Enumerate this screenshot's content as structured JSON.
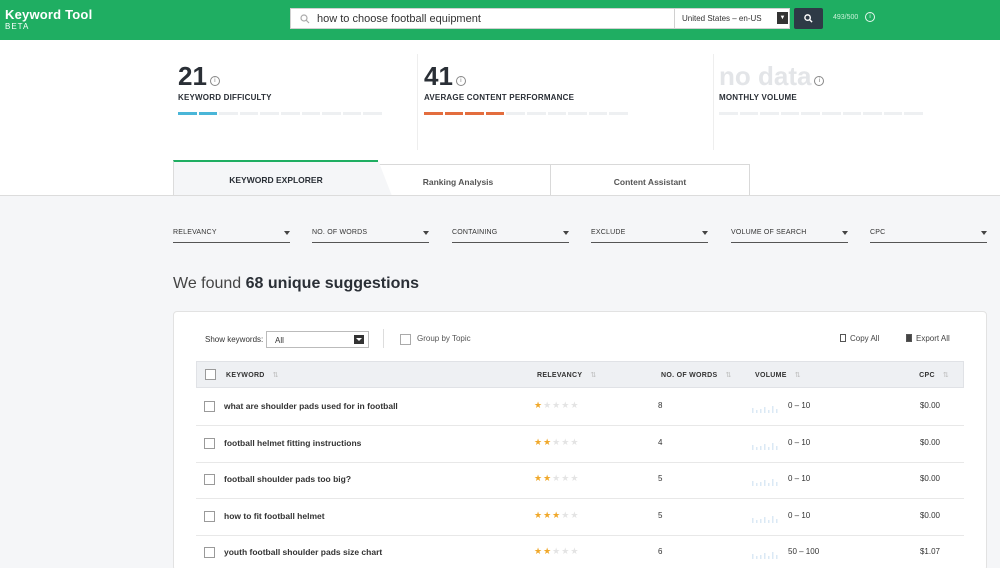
{
  "brand": {
    "title": "Keyword Tool",
    "subtitle": "BETA"
  },
  "search": {
    "query": "how to choose football equipment",
    "locale": "United States – en-US",
    "quota": "493/500"
  },
  "metrics": [
    {
      "value": "21",
      "label": "KEYWORD DIFFICULTY",
      "fill": 0.2,
      "color": "#4ab6d8"
    },
    {
      "value": "41",
      "label": "AVERAGE CONTENT PERFORMANCE",
      "fill": 0.41,
      "color": "#e36d3e"
    },
    {
      "value": "no data",
      "label": "MONTHLY VOLUME",
      "fill": 0,
      "color": "#eef0f2"
    }
  ],
  "tabs": {
    "active": "KEYWORD EXPLORER",
    "second": "Ranking Analysis",
    "third": "Content Assistant"
  },
  "filters": [
    "RELEVANCY",
    "NO. OF WORDS",
    "CONTAINING",
    "EXCLUDE",
    "VOLUME OF SEARCH",
    "CPC"
  ],
  "found": {
    "prefix": "We found",
    "highlight": "68 unique suggestions"
  },
  "toolbar": {
    "show_label": "Show keywords:",
    "show_value": "All",
    "group_label": "Group by Topic",
    "copy_label": "Copy All",
    "export_label": "Export All"
  },
  "table": {
    "columns": {
      "keyword": "KEYWORD",
      "relevancy": "RELEVANCY",
      "words": "NO. OF WORDS",
      "volume": "VOLUME",
      "cpc": "CPC"
    },
    "rows": [
      {
        "keyword": "what are shoulder pads used for in football",
        "stars": 1,
        "words": "8",
        "volume": "0 – 10",
        "cpc": "$0.00"
      },
      {
        "keyword": "football helmet fitting instructions",
        "stars": 2,
        "words": "4",
        "volume": "0 – 10",
        "cpc": "$0.00"
      },
      {
        "keyword": "football shoulder pads too big?",
        "stars": 2,
        "words": "5",
        "volume": "0 – 10",
        "cpc": "$0.00"
      },
      {
        "keyword": "how to fit football helmet",
        "stars": 3,
        "words": "5",
        "volume": "0 – 10",
        "cpc": "$0.00"
      },
      {
        "keyword": "youth football shoulder pads size chart",
        "stars": 2,
        "words": "6",
        "volume": "50 – 100",
        "cpc": "$1.07"
      }
    ]
  },
  "colors": {
    "brand_green": "#1fae62",
    "star": "#f0a82a"
  }
}
